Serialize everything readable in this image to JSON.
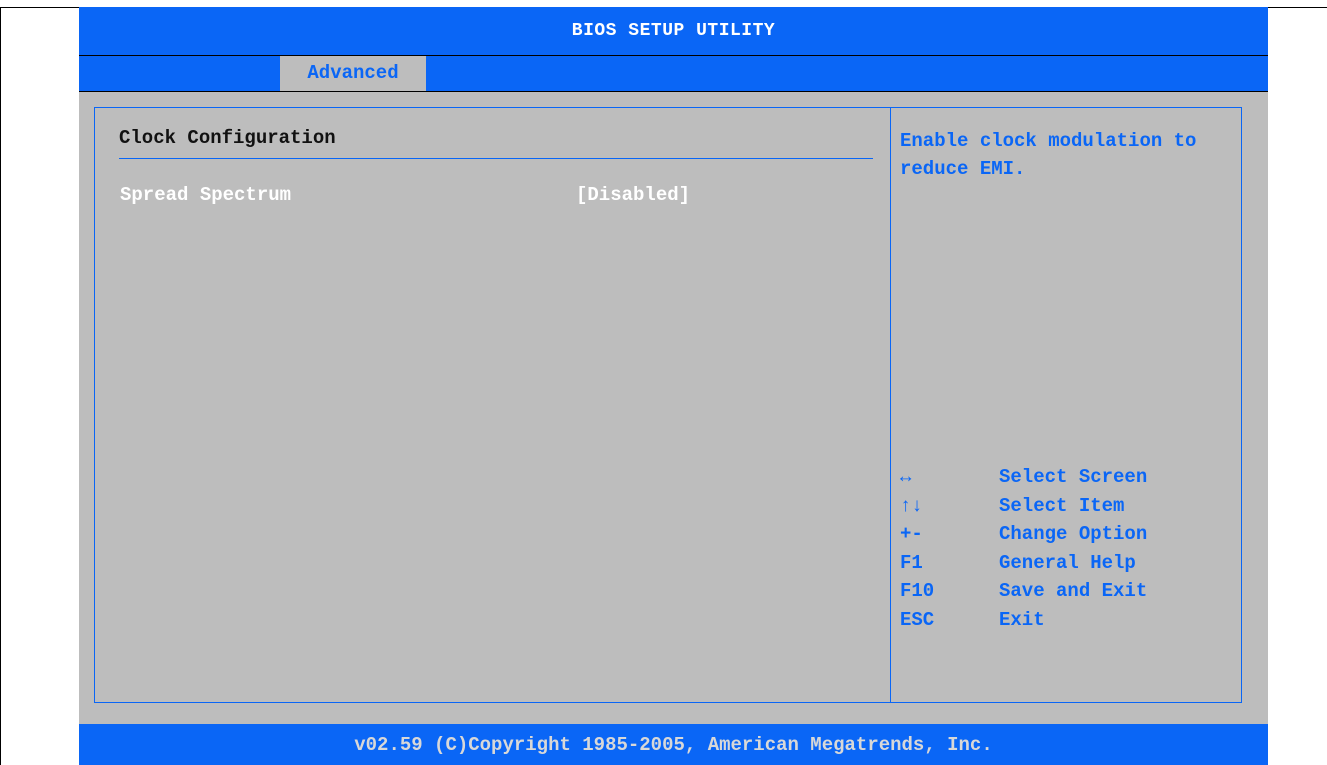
{
  "window": {
    "title": "BIOS SETUP UTILITY"
  },
  "tabs": [
    {
      "label": "Advanced",
      "active": true
    }
  ],
  "section": {
    "title": "Clock Configuration"
  },
  "items": [
    {
      "label": "Spread Spectrum",
      "value": "[Disabled]"
    }
  ],
  "help": {
    "text": "Enable clock modulation to reduce EMI."
  },
  "keys": [
    {
      "key": "↔",
      "description": "Select Screen"
    },
    {
      "key": "↑↓",
      "description": "Select Item"
    },
    {
      "key": "+-",
      "description": "Change Option"
    },
    {
      "key": "F1",
      "description": "General Help"
    },
    {
      "key": "F10",
      "description": "Save and Exit"
    },
    {
      "key": "ESC",
      "description": "Exit"
    }
  ],
  "footer": {
    "text": "v02.59 (C)Copyright 1985-2005, American Megatrends, Inc."
  },
  "colors": {
    "accent": "#0a66f6",
    "background": "#bdbdbd",
    "highlight": "#ffffff"
  }
}
